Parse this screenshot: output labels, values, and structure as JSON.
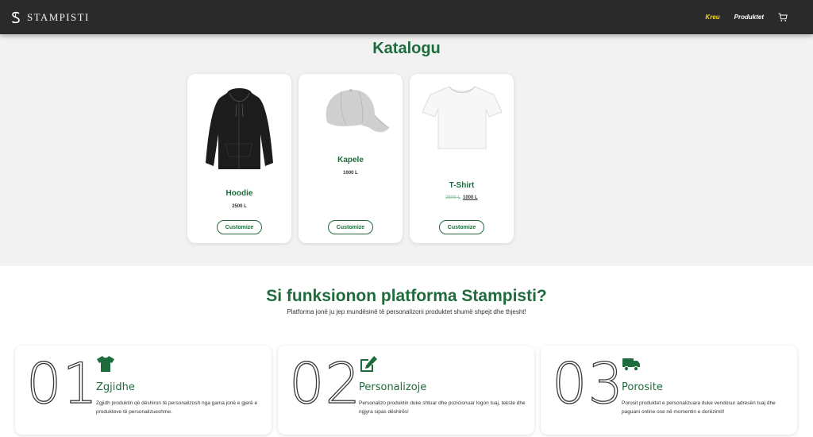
{
  "colors": {
    "navbar": "#2a2a2a",
    "brand_green": "#1e6b3c",
    "active_link": "#f5d60a",
    "catalog_bg": "#f2f2f2"
  },
  "navbar": {
    "brand_name": "STAMPISTI",
    "brand_icon": "s-logo-icon",
    "links": [
      "Kreu",
      "Produktet"
    ],
    "cart_icon": "cart-icon"
  },
  "catalog": {
    "title": "Katalogu",
    "products": [
      {
        "name": "Hoodie",
        "price": "2500 L",
        "button": "Customize",
        "image_icon": "hoodie-icon"
      },
      {
        "name": "Kapele",
        "price": "1000 L",
        "button": "Customize",
        "image_icon": "cap-icon"
      },
      {
        "name": "T-Shirt",
        "old_price": "2500 L",
        "price": "1000 L",
        "button": "Customize",
        "image_icon": "tshirt-icon"
      }
    ]
  },
  "how": {
    "title": "Si funksionon platforma Stampisti?",
    "subtitle": "Platforma jonë ju jep mundësinë të personalizoni produktet shumë shpejt dhe thjesht!",
    "steps": [
      {
        "number": "01",
        "title": "Zgjidhe",
        "icon": "shirt-icon",
        "desc": "Zgjidh produktin që dëshiron të personalizosh nga gama jonë e gjerë e produkteve të personalizueshme."
      },
      {
        "number": "02",
        "title": "Personalizoje",
        "icon": "edit-icon",
        "desc": "Personalizo produktin duke shtuar dhe pozicionuar logon tuaj, tekste dhe ngjyra sipas dëshirës!"
      },
      {
        "number": "03",
        "title": "Porosite",
        "icon": "truck-icon",
        "desc": "Porosit produktet e personalizuara duke vendosur adresën tuaj dhe paguani online ose në momentin e dorëzimit!"
      }
    ]
  }
}
